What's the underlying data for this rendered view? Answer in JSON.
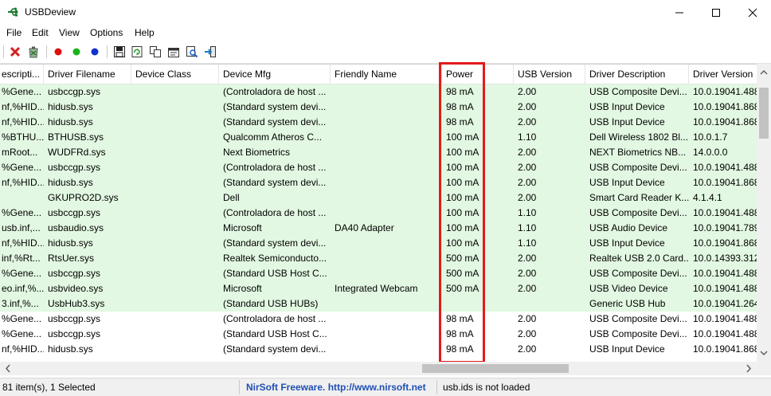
{
  "window": {
    "title": "USBDeview",
    "minimize_label": "—",
    "maximize_label": "☐",
    "close_label": "✕"
  },
  "menu": [
    "File",
    "Edit",
    "View",
    "Options",
    "Help"
  ],
  "toolbar_icons": [
    "delete-icon",
    "uninstall-icon",
    "red-dot-icon",
    "green-dot-icon",
    "blue-dot-icon",
    "save-icon",
    "refresh-icon",
    "copy-icon",
    "properties-icon",
    "find-icon",
    "exit-icon"
  ],
  "colors": {
    "accent_highlight": "#e21b1b",
    "connected_row": "#e2f8e2",
    "status_link": "#1f4fb5"
  },
  "columns": [
    "escripti...",
    "Driver Filename",
    "Device Class",
    "Device Mfg",
    "Friendly Name",
    "Power",
    "USB Version",
    "Driver Description",
    "Driver Version"
  ],
  "rows": [
    {
      "connected": true,
      "cells": [
        "%Gene...",
        "usbccgp.sys",
        "",
        "(Controladora de host ...",
        "",
        "98 mA",
        "2.00",
        "USB Composite Devi...",
        "10.0.19041.488"
      ]
    },
    {
      "connected": true,
      "cells": [
        "nf,%HID...",
        "hidusb.sys",
        "",
        "(Standard system devi...",
        "",
        "98 mA",
        "2.00",
        "USB Input Device",
        "10.0.19041.868"
      ]
    },
    {
      "connected": true,
      "cells": [
        "nf,%HID...",
        "hidusb.sys",
        "",
        "(Standard system devi...",
        "",
        "98 mA",
        "2.00",
        "USB Input Device",
        "10.0.19041.868"
      ]
    },
    {
      "connected": true,
      "cells": [
        "%BTHU...",
        "BTHUSB.sys",
        "",
        "Qualcomm Atheros C...",
        "",
        "100 mA",
        "1.10",
        "Dell Wireless 1802 Bl...",
        "10.0.1.7"
      ]
    },
    {
      "connected": true,
      "cells": [
        "mRoot...",
        "WUDFRd.sys",
        "",
        "Next Biometrics",
        "",
        "100 mA",
        "2.00",
        "NEXT Biometrics NB...",
        "14.0.0.0"
      ]
    },
    {
      "connected": true,
      "cells": [
        "%Gene...",
        "usbccgp.sys",
        "",
        "(Controladora de host ...",
        "",
        "100 mA",
        "2.00",
        "USB Composite Devi...",
        "10.0.19041.488"
      ]
    },
    {
      "connected": true,
      "cells": [
        "nf,%HID...",
        "hidusb.sys",
        "",
        "(Standard system devi...",
        "",
        "100 mA",
        "2.00",
        "USB Input Device",
        "10.0.19041.868"
      ]
    },
    {
      "connected": true,
      "cells": [
        "",
        "GKUPRO2D.sys",
        "",
        "Dell",
        "",
        "100 mA",
        "2.00",
        "Smart Card Reader K...",
        "4.1.4.1"
      ]
    },
    {
      "connected": true,
      "cells": [
        "%Gene...",
        "usbccgp.sys",
        "",
        "(Controladora de host ...",
        "",
        "100 mA",
        "1.10",
        "USB Composite Devi...",
        "10.0.19041.488"
      ]
    },
    {
      "connected": true,
      "cells": [
        "usb.inf,...",
        "usbaudio.sys",
        "",
        "Microsoft",
        "DA40 Adapter",
        "100 mA",
        "1.10",
        "USB Audio Device",
        "10.0.19041.789"
      ]
    },
    {
      "connected": true,
      "cells": [
        "nf,%HID...",
        "hidusb.sys",
        "",
        "(Standard system devi...",
        "",
        "100 mA",
        "1.10",
        "USB Input Device",
        "10.0.19041.868"
      ]
    },
    {
      "connected": true,
      "cells": [
        "inf,%Rt...",
        "RtsUer.sys",
        "",
        "Realtek Semiconducto...",
        "",
        "500 mA",
        "2.00",
        "Realtek USB 2.0 Card...",
        "10.0.14393.3122"
      ]
    },
    {
      "connected": true,
      "cells": [
        "%Gene...",
        "usbccgp.sys",
        "",
        "(Standard USB Host C...",
        "",
        "500 mA",
        "2.00",
        "USB Composite Devi...",
        "10.0.19041.488"
      ]
    },
    {
      "connected": true,
      "cells": [
        "eo.inf,%...",
        "usbvideo.sys",
        "",
        "Microsoft",
        "Integrated Webcam",
        "500 mA",
        "2.00",
        "USB Video Device",
        "10.0.19041.488"
      ]
    },
    {
      "connected": true,
      "cells": [
        "3.inf,%...",
        "UsbHub3.sys",
        "",
        "(Standard USB HUBs)",
        "",
        "",
        "",
        "Generic USB Hub",
        "10.0.19041.264"
      ]
    },
    {
      "connected": false,
      "cells": [
        "%Gene...",
        "usbccgp.sys",
        "",
        "(Controladora de host ...",
        "",
        "98 mA",
        "2.00",
        "USB Composite Devi...",
        "10.0.19041.488"
      ]
    },
    {
      "connected": false,
      "cells": [
        "%Gene...",
        "usbccgp.sys",
        "",
        "(Standard USB Host C...",
        "",
        "98 mA",
        "2.00",
        "USB Composite Devi...",
        "10.0.19041.488"
      ]
    },
    {
      "connected": false,
      "cells": [
        "nf,%HID...",
        "hidusb.sys",
        "",
        "(Standard system devi...",
        "",
        "98 mA",
        "2.00",
        "USB Input Device",
        "10.0.19041.868"
      ]
    }
  ],
  "status": {
    "items": "81 item(s), 1 Selected",
    "freeware": "NirSoft Freeware.  http://www.nirsoft.net",
    "ids": "usb.ids is not loaded"
  }
}
